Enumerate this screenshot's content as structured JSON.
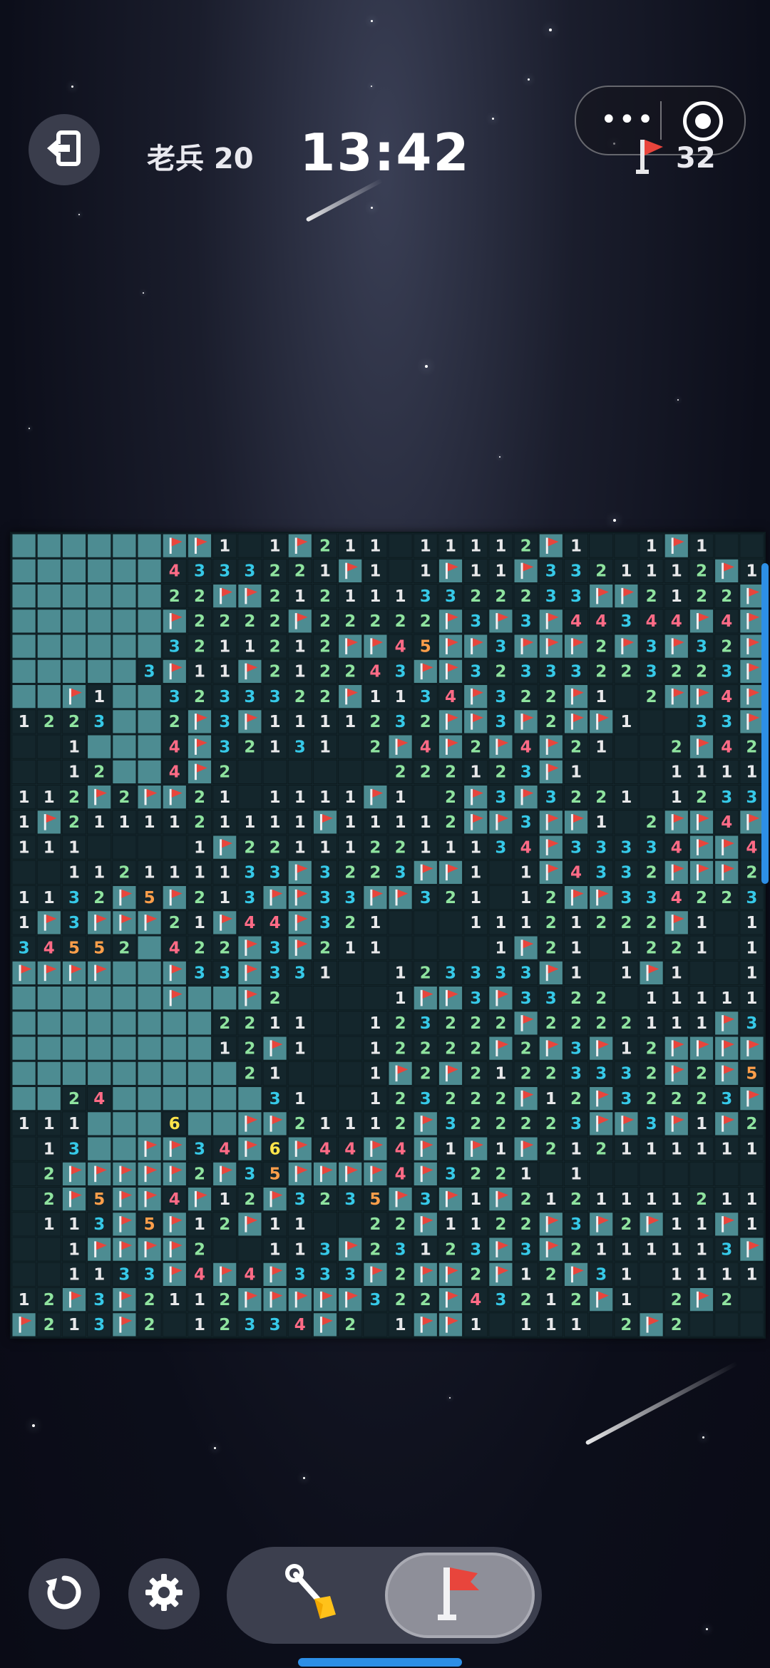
{
  "header": {
    "level_label": "老兵 20",
    "timer": "13:42",
    "flags_remaining": "32"
  },
  "capsule": {
    "menu_glyph": "•••"
  },
  "colors": {
    "num1": "#e8e8ea",
    "num2": "#8fe39f",
    "num3": "#36c9e8",
    "num4": "#ff6b86",
    "num5": "#ff9f4a",
    "num6": "#ffe44a",
    "hidden_cell": "#4d8c92",
    "revealed_cell": "#14262c",
    "flag": "#e8453c",
    "accent": "#2d8fe6"
  },
  "board": {
    "cols": 30,
    "rows": 32,
    "cell_legend": "H = hidden, F = flag, . = empty revealed, 1-6 = adjacent mine count",
    "grid": [
      "HHHHHHFF1.1F211.11112F1..1F1..",
      "HHHHHH4333221F1.1F11F3321112F1",
      "HHHHHH22FF2121113322233FF2122F1",
      "HHHHHHF2222F22222F3F3F44344F4FF3",
      "HHHHHH3211212FF45FF3FFF2F3F32FF",
      "HHHHH3F11F212243FF32333223223F6F",
      "HHF1HH3233322F1134F322F1.2FF4F3FF",
      "1223HH2F3F1111232FF3F2FF1..33FF35F",
      "..1HHH4F32131.2F4F2F4F21..2F42133F",
      "..12HH4F2......222123F1...1111222",
      "112F2FF21.1111F1.2F3F3221.1233F2",
      "1F2111121111F11112FF3FF1.2FF4F",
      "111....1F221112211134F33334FF44F",
      "..112111133F3223FF1.1F4332FFF23F3",
      "1132F5F213FF33FF321.12FF3342233",
      "1F3FFF21F44F321...11121222F1.1FF4F",
      "34552H422F3F211....1F21.1221.13F4",
      "FFFFHHF33F331..123333F1.1F1..14FF",
      "HHHHHHFHHF2....1FF3F3322.1111133FF3",
      "HHHHHHHH2211..123222F2222111F3F31",
      "HHHHHHHH12F1..12222F2F3F12FFFF2F1",
      "HHHHHHHHH21...1F2F21223332F2F532",
      "HH24HHHHHH31..123222F12F32223F2",
      "111HHH6HHFF21112F322223FF3F1F2F",
      ".13HHFF34F6F44F4F1F1F212111111",
      ".2FFFFF2F35FFFF4F3221.1........",
      ".2F5FF4F12F3235F3F1F2121111211",
      ".113F5F12F11..22F1122F3F2F11F113F2",
      "..1FFFF2..113F23123F3F2111113F2",
      "..1133F4F4F333F2FF2F12F31.111111",
      "12F3F2112FFFFF322F43212F1.2F2",
      "F213F2.12334F2.1FF1.111.2F2"
    ]
  }
}
